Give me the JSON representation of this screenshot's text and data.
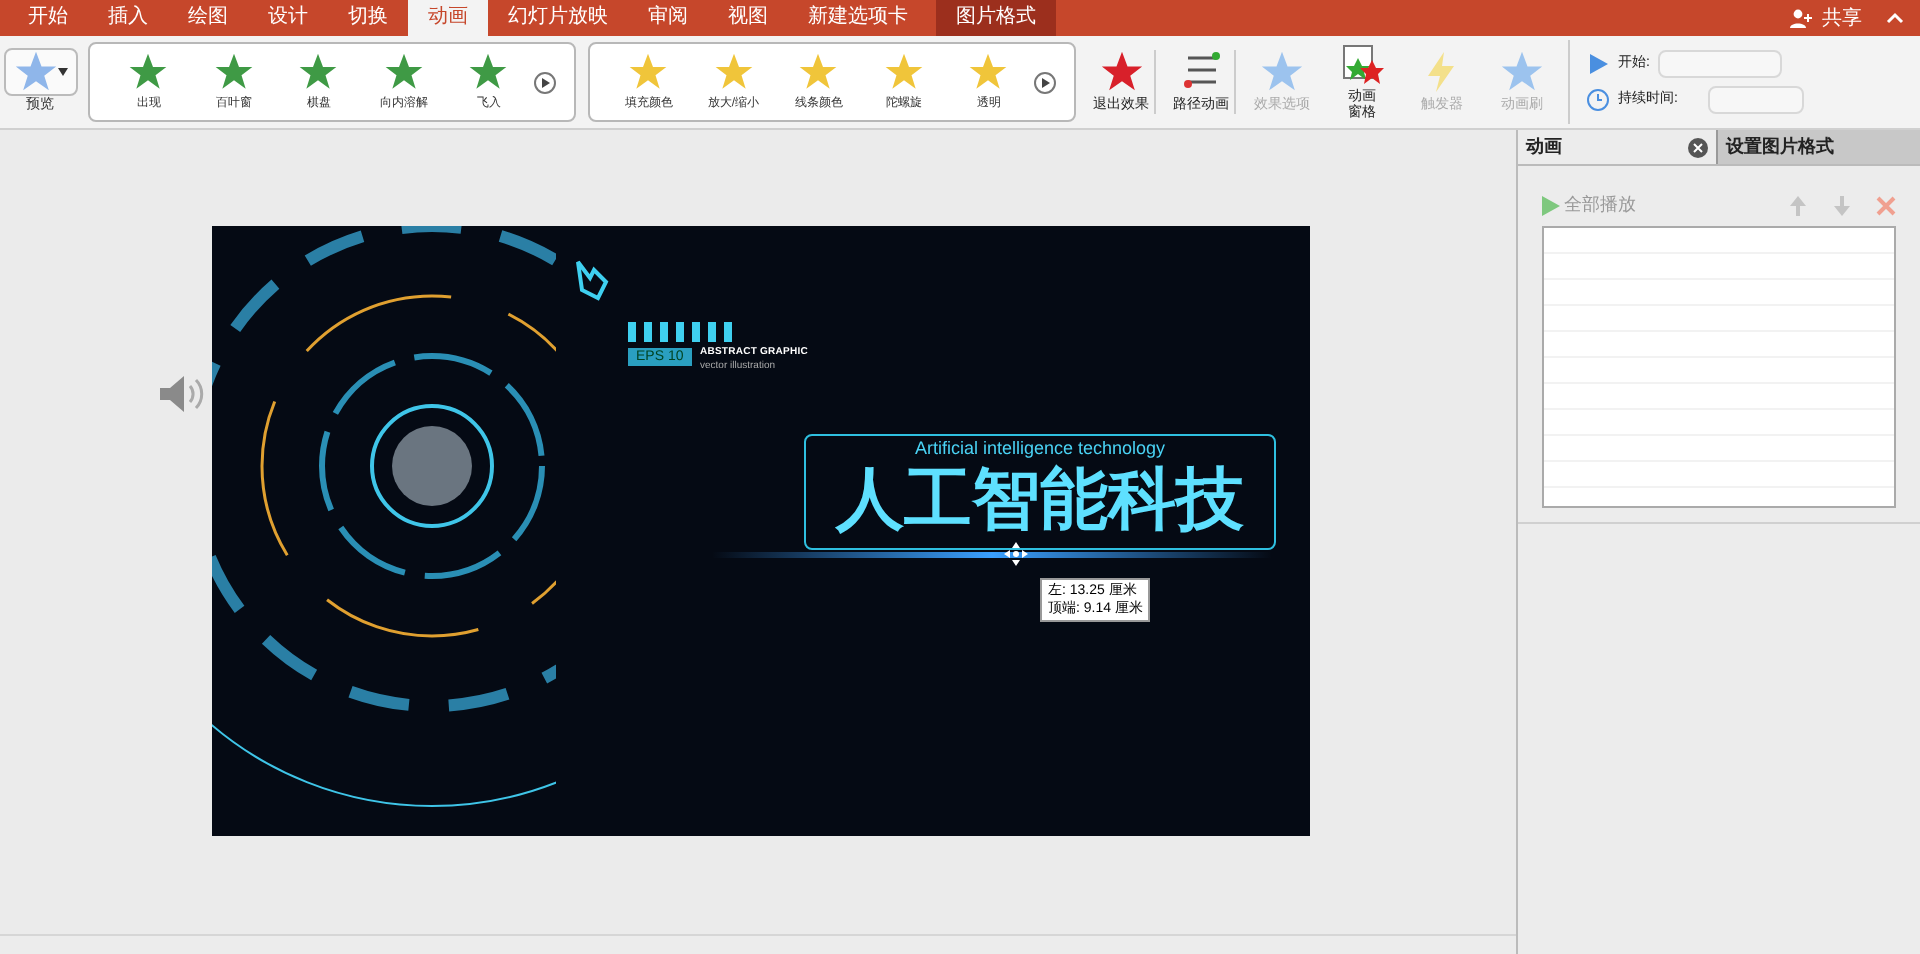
{
  "tabs": [
    {
      "label": "开始",
      "selected": false,
      "kind": "normal"
    },
    {
      "label": "插入",
      "selected": false,
      "kind": "normal"
    },
    {
      "label": "绘图",
      "selected": false,
      "kind": "normal"
    },
    {
      "label": "设计",
      "selected": false,
      "kind": "normal"
    },
    {
      "label": "切换",
      "selected": false,
      "kind": "normal"
    },
    {
      "label": "动画",
      "selected": true,
      "kind": "normal"
    },
    {
      "label": "幻灯片放映",
      "selected": false,
      "kind": "normal"
    },
    {
      "label": "审阅",
      "selected": false,
      "kind": "normal"
    },
    {
      "label": "视图",
      "selected": false,
      "kind": "normal"
    },
    {
      "label": "新建选项卡",
      "selected": false,
      "kind": "normal"
    },
    {
      "label": "图片格式",
      "selected": false,
      "kind": "contextual"
    }
  ],
  "share": {
    "label": "共享"
  },
  "ribbon": {
    "preview": {
      "label": "预览"
    },
    "galleries": [
      {
        "kind": "entrance",
        "items": [
          "出现",
          "百叶窗",
          "棋盘",
          "向内溶解",
          "飞入"
        ]
      },
      {
        "kind": "emphasis",
        "items": [
          "填充颜色",
          "放大/缩小",
          "线条颜色",
          "陀螺旋",
          "透明"
        ]
      }
    ],
    "buttons": [
      {
        "label": "退出效果",
        "kind": "exit",
        "disabled": false
      },
      {
        "label": "路径动画",
        "kind": "path",
        "disabled": false
      },
      {
        "label": "效果选项",
        "kind": "options",
        "disabled": true
      },
      {
        "label": "动画窗格",
        "kind": "pane",
        "disabled": false
      },
      {
        "label": "触发器",
        "kind": "trigger",
        "disabled": true
      },
      {
        "label": "动画刷",
        "kind": "painter",
        "disabled": true
      }
    ],
    "timing": [
      {
        "label": "开始:",
        "kind": "start"
      },
      {
        "label": "持续时间:",
        "kind": "duration"
      }
    ]
  },
  "slide": {
    "caption_en": "Artificial intelligence technology",
    "title": "人工智能科技",
    "badge": "EPS 10",
    "heading": "ABSTRACT GRAPHIC",
    "subheading": "vector illustration",
    "tooltip": [
      "左: 13.25 厘米",
      "顶端: 9.14 厘米"
    ]
  },
  "pane": {
    "tabs": [
      {
        "label": "动画",
        "selected": true
      },
      {
        "label": "设置图片格式",
        "selected": false
      }
    ],
    "play_all": "全部播放"
  }
}
